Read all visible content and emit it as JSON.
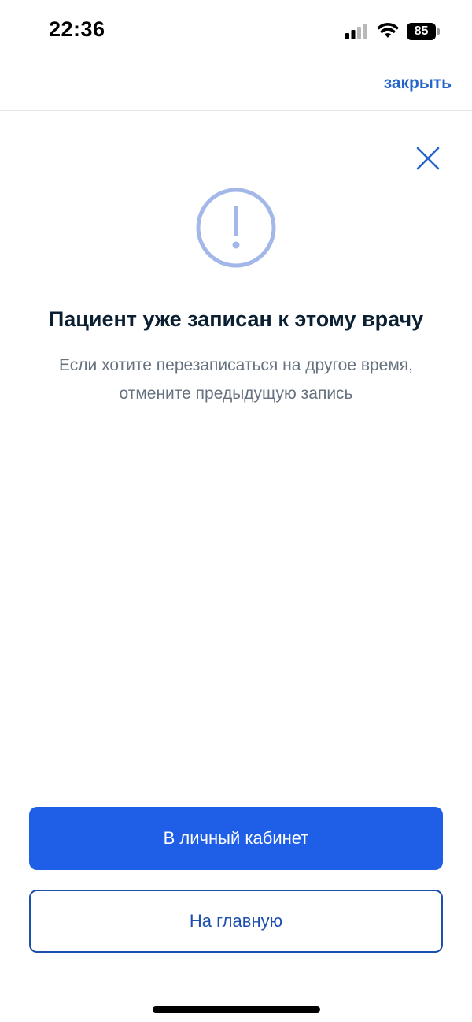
{
  "status_bar": {
    "time": "22:36",
    "battery_level": "85",
    "signal_icon": "cellular-signal-icon",
    "wifi_icon": "wifi-icon",
    "battery_icon": "battery-icon"
  },
  "nav": {
    "close_label": "закрыть"
  },
  "dialog": {
    "close_icon": "close-icon",
    "alert_icon": "exclamation-circle-icon",
    "title": "Пациент уже записан к этому врачу",
    "subtitle_line1": "Если хотите перезаписаться на другое время,",
    "subtitle_line2": "отмените предыдущую запись"
  },
  "actions": {
    "primary_label": "В личный кабинет",
    "secondary_label": "На главную"
  },
  "colors": {
    "accent": "#1f5fe8",
    "link": "#2565c9",
    "alert_icon": "#a3b8e8",
    "title": "#0b1f33",
    "subtitle": "#66727f"
  }
}
